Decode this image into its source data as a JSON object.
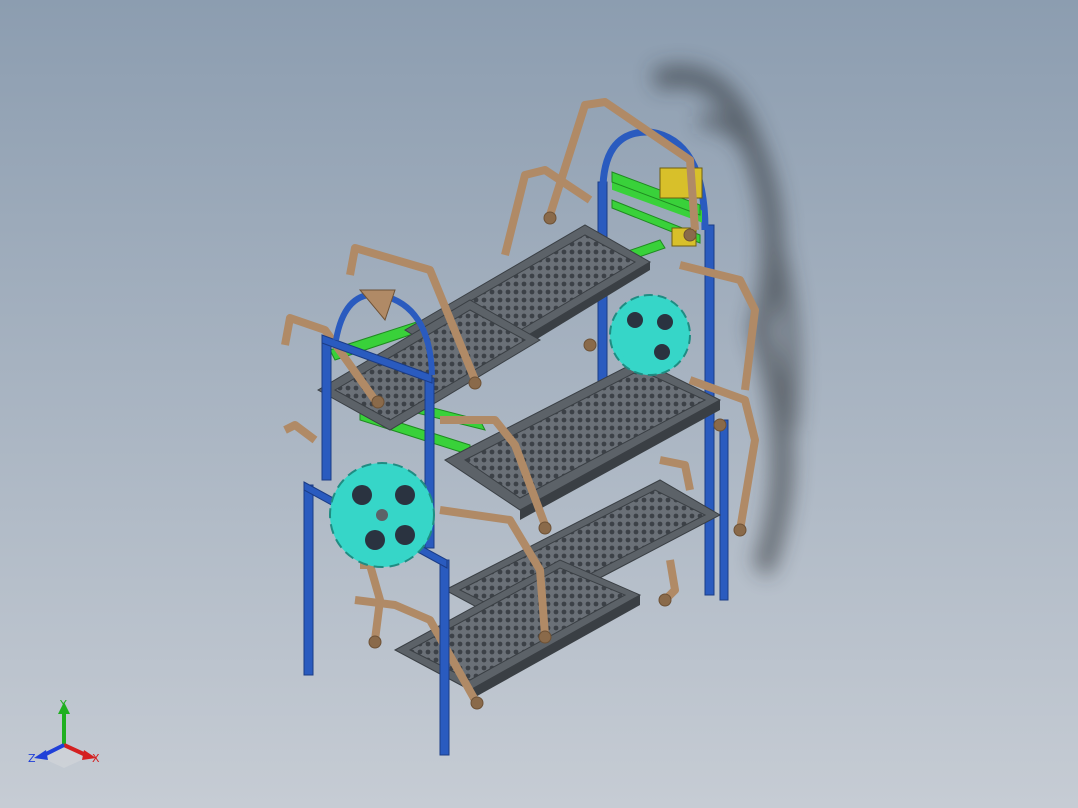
{
  "viewport": {
    "background_top": "#8c9db0",
    "background_bottom": "#c6ccd4"
  },
  "model": {
    "colors": {
      "frame_blue": "#2a5bbf",
      "frame_blue_dark": "#1b3c86",
      "arm_bronze": "#b08a66",
      "arm_bronze_dark": "#6e5236",
      "tray_grey": "#5c6268",
      "tray_grey_dark": "#3a3f44",
      "gear_cyan": "#36d6c8",
      "rail_green": "#39d13a",
      "motor_yellow": "#d8c02a"
    }
  },
  "triad": {
    "x_label": "X",
    "y_label": "Y",
    "z_label": "Z",
    "x_color": "#d42020",
    "y_color": "#20b020",
    "z_color": "#2040d8"
  }
}
